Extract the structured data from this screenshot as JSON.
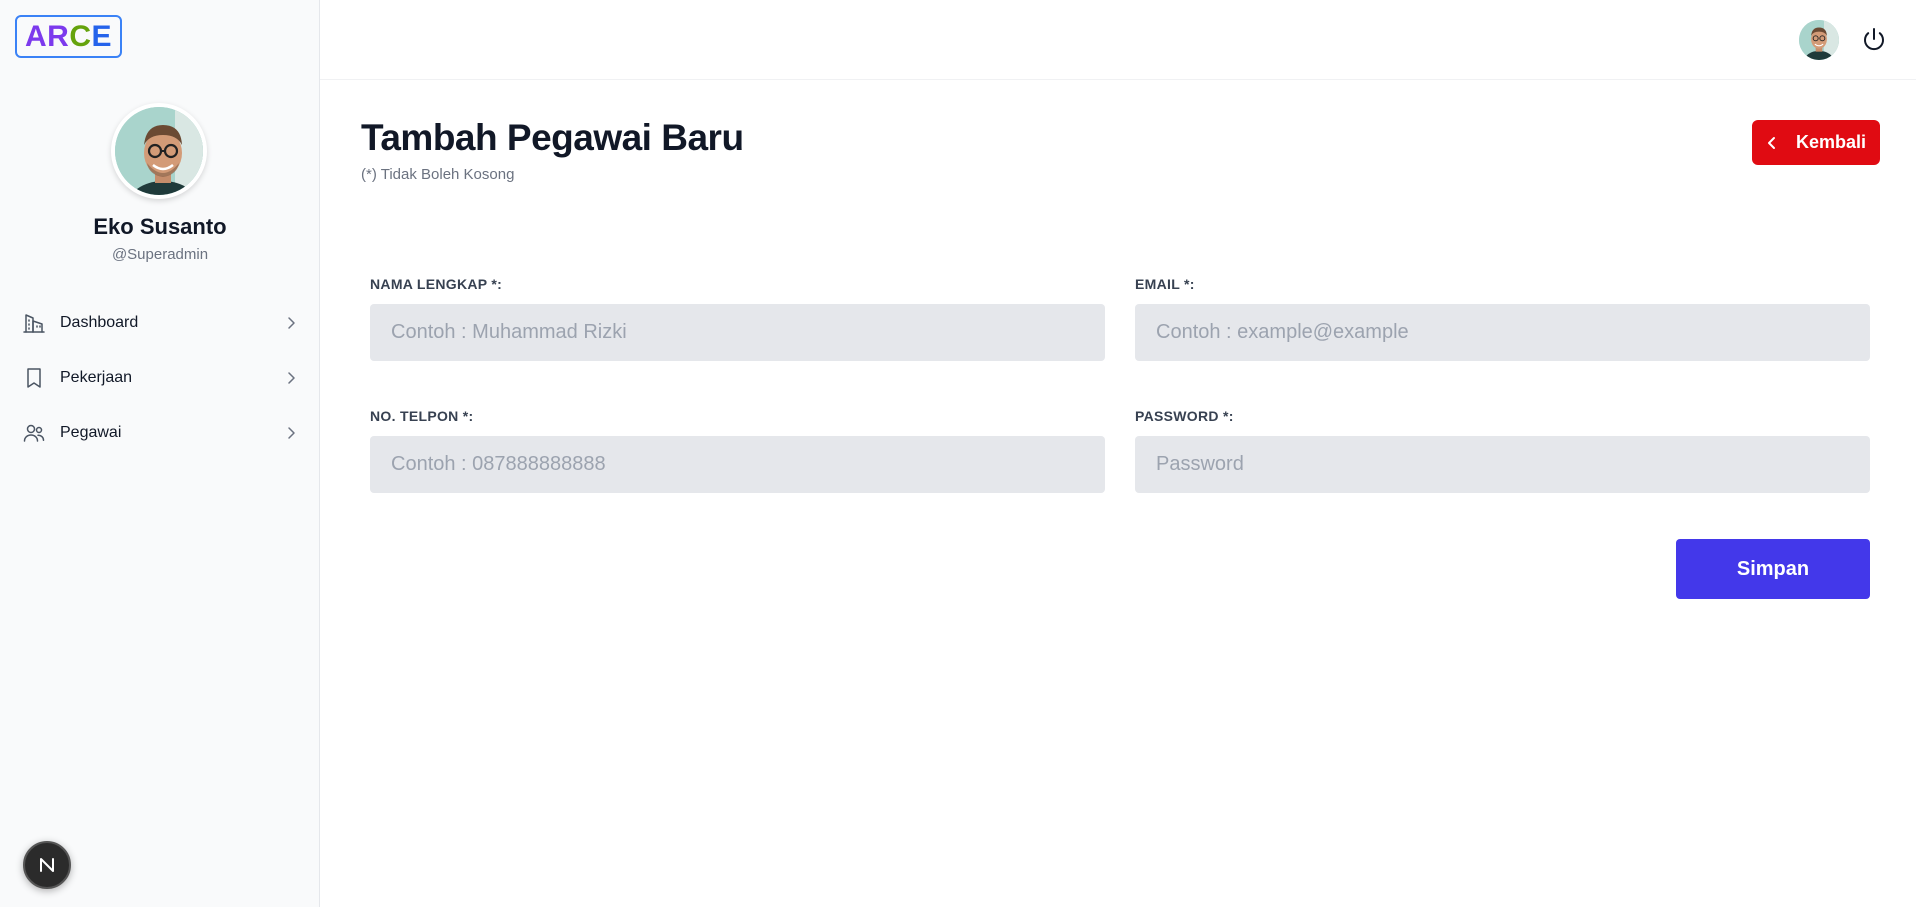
{
  "brand": {
    "logo_letters": [
      "A",
      "R",
      "C",
      "E"
    ]
  },
  "profile": {
    "name": "Eko Susanto",
    "handle": "@Superadmin"
  },
  "sidebar": {
    "items": [
      {
        "label": "Dashboard",
        "icon": "building-icon"
      },
      {
        "label": "Pekerjaan",
        "icon": "bookmark-icon"
      },
      {
        "label": "Pegawai",
        "icon": "users-icon"
      }
    ]
  },
  "header": {
    "avatar_icon": "user-avatar",
    "power_icon": "power-icon"
  },
  "main": {
    "title": "Tambah Pegawai Baru",
    "subtitle": "(*) Tidak Boleh Kosong",
    "back_label": "Kembali",
    "save_label": "Simpan",
    "form": {
      "nama": {
        "label": "NAMA LENGKAP *:",
        "placeholder": "Contoh : Muhammad Rizki",
        "value": ""
      },
      "email": {
        "label": "EMAIL *:",
        "placeholder": "Contoh : example@example",
        "value": ""
      },
      "telpon": {
        "label": "NO. TELPON *:",
        "placeholder": "Contoh : 087888888888",
        "value": ""
      },
      "password": {
        "label": "PASSWORD *:",
        "placeholder": "Password",
        "value": ""
      }
    }
  },
  "colors": {
    "accent": "#4338ea",
    "danger": "#e00b12",
    "input_bg": "#e5e7eb",
    "sidebar_bg": "#f9fafb"
  },
  "misc": {
    "dev_badge_letter": "N"
  }
}
